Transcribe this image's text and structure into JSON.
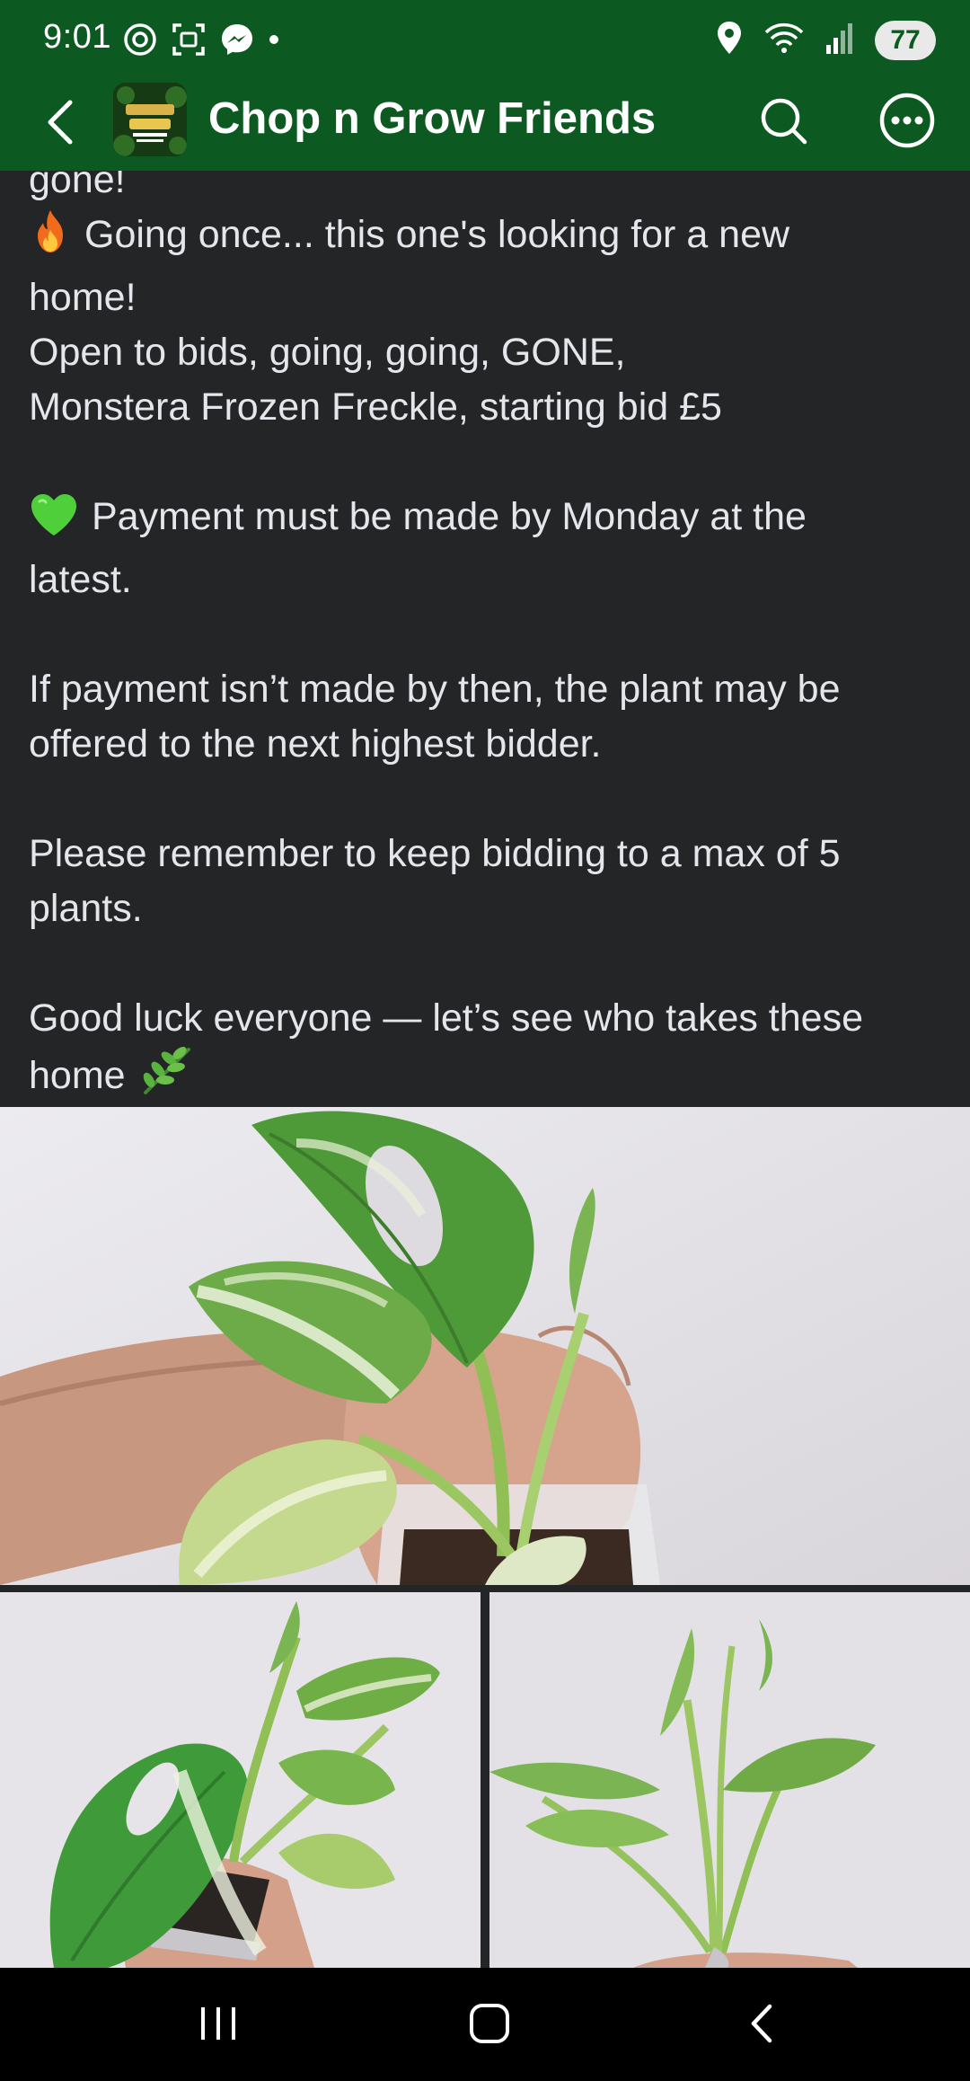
{
  "status_bar": {
    "time": "9:01",
    "battery": "77",
    "left_icons": [
      "threads-icon",
      "screenshot-icon",
      "messenger-icon",
      "dot-icon"
    ],
    "right_icons": [
      "location-icon",
      "wifi-icon",
      "signal-icon",
      "battery-icon"
    ]
  },
  "header": {
    "group_name": "Chop n Grow Friends",
    "avatar_icon": "group-logo-icon",
    "back_icon": "back-arrow-icon",
    "search_icon": "search-icon",
    "more_icon": "more-options-icon",
    "colors": {
      "background": "#0c5a21",
      "text": "#ffffff"
    }
  },
  "post": {
    "lines": [
      "gone!",
      "Going once... this one's looking for a new",
      "home!",
      "Open to bids, going, going, GONE,",
      "Monstera Frozen Freckle, starting bid £5",
      "",
      "Payment must be made by Monday at the",
      "latest.",
      "",
      "If payment isn’t made by then, the plant may be",
      "offered to the next highest bidder.",
      "",
      "Please remember to keep bidding to a max of 5",
      "plants.",
      "",
      "Good luck everyone — let’s see who takes these",
      "home"
    ],
    "emoji": {
      "fire": "fire-icon",
      "green_heart": "green-heart-icon",
      "herb": "herb-icon"
    }
  },
  "photos": [
    {
      "name": "photo-main",
      "subject": "monstera-plant-photo"
    },
    {
      "name": "photo-left",
      "subject": "monstera-plant-photo"
    },
    {
      "name": "photo-right",
      "subject": "monstera-plant-photo"
    }
  ],
  "nav_bar": {
    "recents_icon": "recent-apps-icon",
    "home_icon": "home-icon",
    "back_icon": "nav-back-icon"
  }
}
